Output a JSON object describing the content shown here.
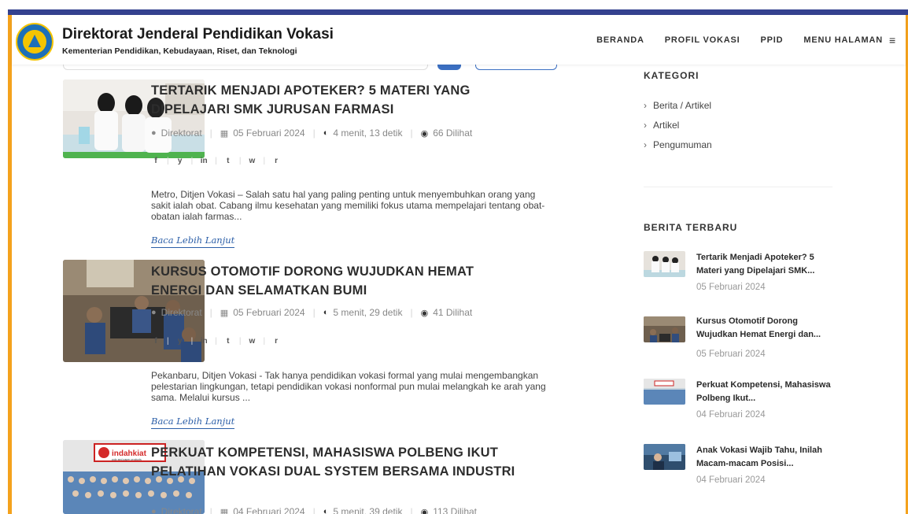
{
  "header": {
    "title": "Direktorat Jenderal Pendidikan Vokasi",
    "subtitle": "Kementerian Pendidikan, Kebudayaan, Riset, dan Teknologi",
    "nav": [
      "BERANDA",
      "PROFIL VOKASI",
      "PPID",
      "MENU HALAMAN"
    ],
    "menu_icon": "≡"
  },
  "articles": [
    {
      "title": "TERTARIK MENJADI APOTEKER? 5 MATERI YANG DIPELAJARI SMK JURUSAN FARMASI",
      "author": "Direktorat",
      "date": "05 Februari 2024",
      "read_time": "4 menit, 13 detik",
      "views": "66 Dilihat",
      "excerpt": "Metro, Ditjen Vokasi – Salah satu hal yang paling penting untuk menyembuhkan orang yang sakit ialah obat. Cabang ilmu kesehatan yang memiliki fokus utama mempelajari tentang obat-obatan ialah farmas...",
      "more": "Baca Lebih Lanjut"
    },
    {
      "title": "KURSUS OTOMOTIF DORONG WUJUDKAN HEMAT ENERGI DAN SELAMATKAN BUMI",
      "author": "Direktorat",
      "date": "05 Februari 2024",
      "read_time": "5 menit, 29 detik",
      "views": "41 Dilihat",
      "excerpt": "Pekanbaru, Ditjen Vokasi - Tak hanya pendidikan vokasi formal yang mulai mengembangkan pelestarian lingkungan, tetapi pendidikan vokasi nonformal pun mulai melangkah ke arah yang sama. Melalui kursus ...",
      "more": "Baca Lebih Lanjut"
    },
    {
      "title": "PERKUAT KOMPETENSI, MAHASISWA POLBENG IKUT PELATIHAN VOKASI DUAL SYSTEM BERSAMA INDUSTRI",
      "author": "Direktorat",
      "date": "04 Februari 2024",
      "read_time": "5 menit, 39 detik",
      "views": "113 Dilihat",
      "banner_text": "indahkiat",
      "banner_sub": "pulp and paper products"
    }
  ],
  "share_icons": [
    "f",
    "y",
    "in",
    "t",
    "w",
    "r"
  ],
  "sidebar": {
    "categories_heading": "KATEGORI",
    "categories": [
      "Berita / Artikel",
      "Artikel",
      "Pengumuman"
    ],
    "recent_heading": "BERITA TERBARU",
    "recent": [
      {
        "title": "Tertarik Menjadi Apoteker? 5 Materi yang Dipelajari SMK...",
        "date": "05 Februari 2024"
      },
      {
        "title": "Kursus Otomotif Dorong Wujudkan Hemat Energi dan...",
        "date": "05 Februari 2024"
      },
      {
        "title": "Perkuat Kompetensi, Mahasiswa Polbeng Ikut...",
        "date": "04 Februari 2024"
      },
      {
        "title": "Anak Vokasi Wajib Tahu, Inilah Macam-macam Posisi...",
        "date": "04 Februari 2024"
      }
    ]
  },
  "colors": {
    "top_stripe": "#34418f",
    "accent_orange": "#f4a21d",
    "link_blue": "#2c5fa8"
  }
}
